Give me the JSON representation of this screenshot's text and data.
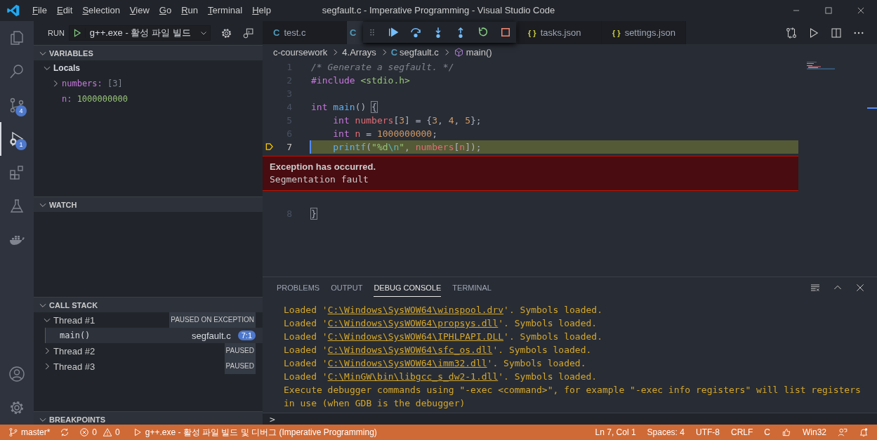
{
  "window": {
    "title": "segfault.c - Imperative Programming - Visual Studio Code"
  },
  "menu": [
    "File",
    "Edit",
    "Selection",
    "View",
    "Go",
    "Run",
    "Terminal",
    "Help"
  ],
  "activity_bar": {
    "top": [
      {
        "kind": "explorer",
        "selected": false
      },
      {
        "kind": "search",
        "selected": false
      },
      {
        "kind": "source-control",
        "badge": "4",
        "selected": false
      },
      {
        "kind": "run",
        "badge": "1",
        "selected": true
      },
      {
        "kind": "extensions",
        "selected": false
      },
      {
        "kind": "testing",
        "selected": false
      },
      {
        "kind": "docker",
        "selected": false
      }
    ],
    "bottom": [
      {
        "kind": "account"
      },
      {
        "kind": "settings"
      }
    ]
  },
  "run_bar": {
    "label": "RUN",
    "configuration": "g++.exe - 활성 파일 빌드"
  },
  "sidebar": {
    "sections": [
      {
        "kind": "variables",
        "title": "VARIABLES",
        "expanded": true,
        "scopes": [
          {
            "name": "Locals",
            "expanded": true,
            "variables": [
              {
                "name": "numbers:",
                "value": "[3]",
                "expanded": false
              },
              {
                "name": "n:",
                "value": "1000000000"
              }
            ]
          }
        ]
      },
      {
        "kind": "watch",
        "title": "WATCH",
        "expanded": true
      },
      {
        "kind": "call_stack",
        "title": "CALL STACK",
        "expanded": true,
        "threads": [
          {
            "name": "Thread #1",
            "status": "PAUSED ON EXCEPTION",
            "expanded": true,
            "frames": [
              {
                "name": "main()",
                "file": "segfault.c",
                "position": "7:1",
                "selected": true
              }
            ]
          },
          {
            "name": "Thread #2",
            "status": "PAUSED",
            "expanded": false
          },
          {
            "name": "Thread #3",
            "status": "PAUSED",
            "expanded": false
          }
        ]
      },
      {
        "kind": "breakpoints",
        "title": "BREAKPOINTS",
        "expanded": true
      }
    ]
  },
  "editor": {
    "tabs": [
      {
        "glyph": "C",
        "kind": "c",
        "label": "test.c",
        "selected": false
      },
      {
        "glyph": "C",
        "kind": "c",
        "selected": true
      },
      {
        "glyph": "{ }",
        "kind": "json",
        "label": "tasks.json",
        "selected": false
      },
      {
        "glyph": "{ }",
        "kind": "json",
        "label": "settings.json",
        "selected": false
      }
    ],
    "debug_toolbar": [
      {
        "kind": "continue"
      },
      {
        "kind": "step-over"
      },
      {
        "kind": "step-into"
      },
      {
        "kind": "step-out"
      },
      {
        "kind": "restart"
      },
      {
        "kind": "stop"
      }
    ],
    "breadcrumb": [
      {
        "kind": "folder",
        "text": "c-coursework"
      },
      {
        "kind": "folder",
        "text": "4.Arrays"
      },
      {
        "kind": "file",
        "glyph": "C",
        "text": "segfault.c"
      },
      {
        "kind": "symbol",
        "text": "main()"
      }
    ],
    "lines": [
      {
        "number": "1",
        "tokens": [
          {
            "text": "/* Generate a segfault. */",
            "kind": "comment"
          }
        ]
      },
      {
        "number": "2",
        "tokens": [
          {
            "text": "#include",
            "kind": "keyword"
          },
          {
            "text": " <stdio.h>",
            "kind": "string"
          }
        ]
      },
      {
        "number": "3"
      },
      {
        "number": "4",
        "tokens": [
          {
            "text": "int",
            "kind": "keyword"
          },
          {
            "text": " main",
            "kind": "function"
          },
          {
            "text": "() ",
            "kind": "punct"
          },
          {
            "text": "{",
            "kind": "bracket"
          }
        ]
      },
      {
        "number": "5",
        "indented": true,
        "tokens": [
          {
            "text": "int",
            "kind": "keyword"
          },
          {
            "text": " numbers",
            "kind": "variable"
          },
          {
            "text": "[",
            "kind": "punct"
          },
          {
            "text": "3",
            "kind": "number"
          },
          {
            "text": "] = {",
            "kind": "punct"
          },
          {
            "text": "3",
            "kind": "number"
          },
          {
            "text": ", ",
            "kind": "punct"
          },
          {
            "text": "4",
            "kind": "number"
          },
          {
            "text": ", ",
            "kind": "punct"
          },
          {
            "text": "5",
            "kind": "number"
          },
          {
            "text": "};",
            "kind": "punct"
          }
        ]
      },
      {
        "number": "6",
        "indented": true,
        "tokens": [
          {
            "text": "int",
            "kind": "keyword"
          },
          {
            "text": " n",
            "kind": "variable"
          },
          {
            "text": " = ",
            "kind": "punct"
          },
          {
            "text": "1000000000",
            "kind": "number"
          },
          {
            "text": ";",
            "kind": "punct"
          }
        ]
      },
      {
        "number": "7",
        "indented": true,
        "current": true,
        "tokens": [
          {
            "text": "printf",
            "kind": "function"
          },
          {
            "text": "(",
            "kind": "punct"
          },
          {
            "text": "\"%d",
            "kind": "string"
          },
          {
            "text": "\\n",
            "kind": "escape"
          },
          {
            "text": "\"",
            "kind": "string"
          },
          {
            "text": ", ",
            "kind": "punct"
          },
          {
            "text": "numbers",
            "kind": "variable"
          },
          {
            "text": "[",
            "kind": "punct"
          },
          {
            "text": "n",
            "kind": "variable"
          },
          {
            "text": "]);",
            "kind": "punct"
          }
        ]
      },
      {
        "number": "8",
        "tokens": [
          {
            "text": "}",
            "kind": "bracket"
          }
        ]
      }
    ],
    "exception": {
      "title": "Exception has occurred.",
      "message": "Segmentation fault"
    },
    "actions": [
      {
        "kind": "compare"
      },
      {
        "kind": "run"
      },
      {
        "kind": "split"
      },
      {
        "kind": "more"
      }
    ]
  },
  "panel": {
    "tabs": [
      {
        "label": "PROBLEMS",
        "selected": false
      },
      {
        "label": "OUTPUT",
        "selected": false
      },
      {
        "label": "DEBUG CONSOLE",
        "selected": true
      },
      {
        "label": "TERMINAL",
        "selected": false
      }
    ],
    "console": [
      {
        "kind": "loaded",
        "before": "Loaded '",
        "link": "C:\\Windows\\SysWOW64\\winspool.drv",
        "after": "'. Symbols loaded."
      },
      {
        "kind": "loaded",
        "before": "Loaded '",
        "link": "C:\\Windows\\SysWOW64\\propsys.dll",
        "after": "'. Symbols loaded."
      },
      {
        "kind": "loaded",
        "before": "Loaded '",
        "link": "C:\\Windows\\SysWOW64\\IPHLPAPI.DLL",
        "after": "'. Symbols loaded."
      },
      {
        "kind": "loaded",
        "before": "Loaded '",
        "link": "C:\\Windows\\SysWOW64\\sfc_os.dll",
        "after": "'. Symbols loaded."
      },
      {
        "kind": "loaded",
        "before": "Loaded '",
        "link": "C:\\Windows\\SysWOW64\\imm32.dll",
        "after": "'. Symbols loaded."
      },
      {
        "kind": "loaded",
        "before": "Loaded '",
        "link": "C:\\MinGW\\bin\\libgcc_s_dw2-1.dll",
        "after": "'. Symbols loaded."
      },
      {
        "kind": "text",
        "text": "Execute debugger commands using \"-exec <command>\", for example \"-exec info registers\" will list registers in use (when GDB is the debugger)"
      }
    ],
    "prompt": ">"
  },
  "status_bar": {
    "left": [
      {
        "kind": "branch",
        "text": "master*"
      },
      {
        "kind": "sync"
      },
      {
        "kind": "problems",
        "errors": "0",
        "warnings": "0"
      },
      {
        "kind": "launch",
        "text": "g++.exe - 활성 파일 빌드 및 디버그 (Imperative Programming)"
      }
    ],
    "right": [
      {
        "kind": "text",
        "text": "Ln 7, Col 1"
      },
      {
        "kind": "text",
        "text": "Spaces: 4"
      },
      {
        "kind": "text",
        "text": "UTF-8"
      },
      {
        "kind": "text",
        "text": "CRLF"
      },
      {
        "kind": "text",
        "text": "C"
      },
      {
        "kind": "feedback"
      },
      {
        "kind": "text",
        "text": "Win32"
      },
      {
        "kind": "live-share"
      },
      {
        "kind": "notifications"
      }
    ]
  }
}
